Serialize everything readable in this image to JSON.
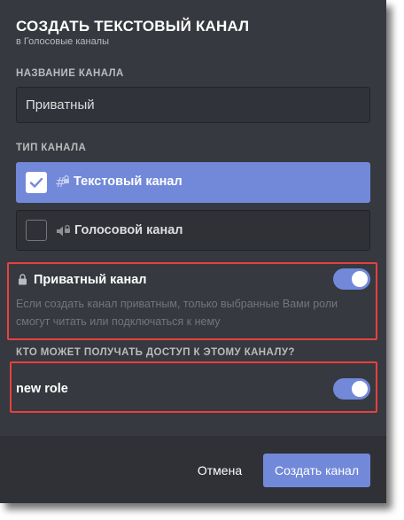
{
  "dialog": {
    "title": "СОЗДАТЬ ТЕКСТОВЫЙ КАНАЛ",
    "subtitle": "в Голосовые каналы"
  },
  "channel_name": {
    "label": "НАЗВАНИЕ КАНАЛА",
    "value": "Приватный"
  },
  "channel_type": {
    "label": "ТИП КАНАЛА",
    "options": [
      {
        "label": "Текстовый канал",
        "icon": "text-channel-lock-icon",
        "selected": true
      },
      {
        "label": "Голосовой канал",
        "icon": "voice-channel-lock-icon",
        "selected": false
      }
    ]
  },
  "private": {
    "label": "Приватный канал",
    "description": "Если создать канал приватным, только выбранные Вами роли смогут читать или подключаться к нему",
    "enabled": true
  },
  "access": {
    "label": "КТО МОЖЕТ ПОЛУЧАТЬ ДОСТУП К ЭТОМУ КАНАЛУ?",
    "roles": [
      {
        "name": "new role",
        "enabled": true
      }
    ]
  },
  "footer": {
    "cancel_label": "Отмена",
    "create_label": "Создать канал"
  },
  "colors": {
    "accent": "#7289da",
    "background": "#36393f",
    "footer_bg": "#2f3136",
    "highlight": "#e8403f"
  }
}
